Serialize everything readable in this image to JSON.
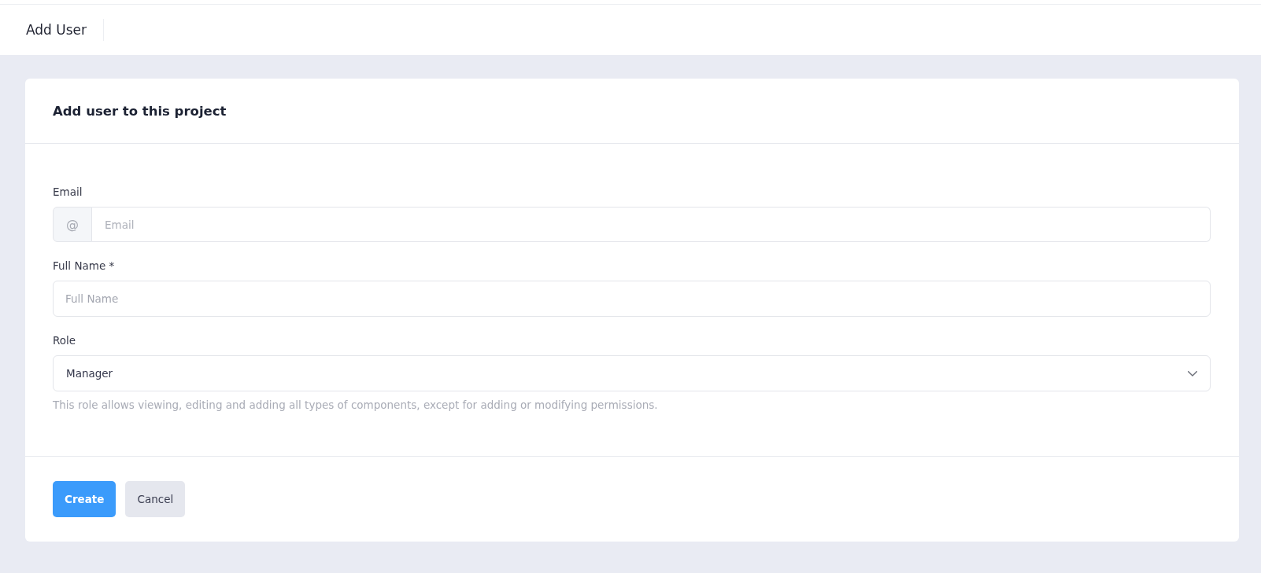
{
  "header": {
    "title": "Add User"
  },
  "card": {
    "title": "Add user to this project",
    "fields": [
      {
        "kind": "email",
        "label": "Email",
        "addon": "@",
        "placeholder": "Email"
      },
      {
        "kind": "text",
        "label": "Full Name *",
        "placeholder": "Full Name"
      },
      {
        "kind": "select",
        "label": "Role",
        "value": "Manager",
        "help": "This role allows viewing, editing and adding all types of components, except for adding or modifying permissions."
      }
    ],
    "buttons": [
      {
        "kind": "primary",
        "label": "Create"
      },
      {
        "kind": "secondary",
        "label": "Cancel"
      }
    ]
  }
}
